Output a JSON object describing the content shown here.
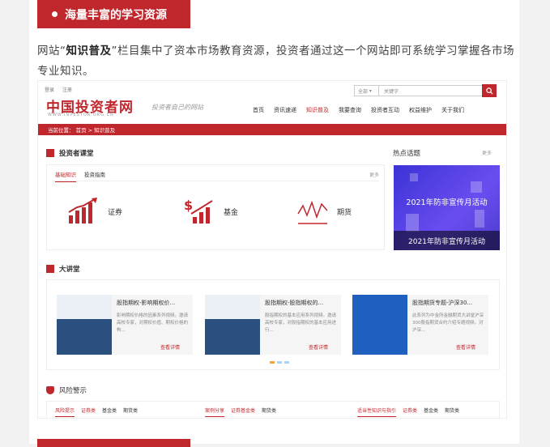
{
  "section_title": "海量丰富的学习资源",
  "intro": {
    "p1": "网站“",
    "bold": "知识普及",
    "p2": "”栏目集中了资本市场教育资源，投资者通过这一个网站即可系统学习掌握各市场专业知识。"
  },
  "site": {
    "top_links": [
      "登录",
      "注册"
    ],
    "search": {
      "select": "全部",
      "placeholder": "关键字"
    },
    "logo": "中国投资者网",
    "logo_sub": "WWW.INVESTOR.ORG.CN",
    "slogan": "投资者自己的网站",
    "nav": [
      "首页",
      "资讯速递",
      "知识普及",
      "我要查询",
      "投资者互动",
      "权益维护",
      "关于我们"
    ],
    "nav_active": "知识普及",
    "breadcrumb": "当前位置：  首页 > 知识普及",
    "courses": {
      "title": "投资者课堂",
      "tabs": [
        "基础知识",
        "投资指南"
      ],
      "more": "更多",
      "items": [
        "证券",
        "基金",
        "期货"
      ]
    },
    "hot": {
      "title": "热点话题",
      "more": "更多",
      "banner_top": "2021年防非宣传月活动",
      "banner_caption": "2021年防非宣传月活动"
    },
    "lecture": {
      "title": "大讲堂",
      "cards": [
        {
          "title": "股指期权-影响期权价...",
          "desc": "影响期权价格的因素系列视频。邀请高校专家，对期权价值、期权价格的构...",
          "link": "查看详情"
        },
        {
          "title": "股指期权-股指期权的...",
          "desc": "股指期权的基本应用系列视频。邀请高校专家，对股指期权的基本应用进行...",
          "link": "查看详情"
        },
        {
          "title": "股指期货专题-沪深30...",
          "desc": "此系列为中金所金融期货大讲堂沪深300股指期货合约介绍专题视频。对沪深...",
          "link": "查看详情"
        }
      ]
    },
    "risk": {
      "title": "风险警示",
      "col1": [
        "风险提示",
        "证券类",
        "基金类",
        "期货类"
      ],
      "col2": [
        "案例分享",
        "证券基金类",
        "期货类"
      ],
      "col3": [
        "适当性知识与指引",
        "证券类",
        "基金类",
        "期货类"
      ]
    }
  }
}
